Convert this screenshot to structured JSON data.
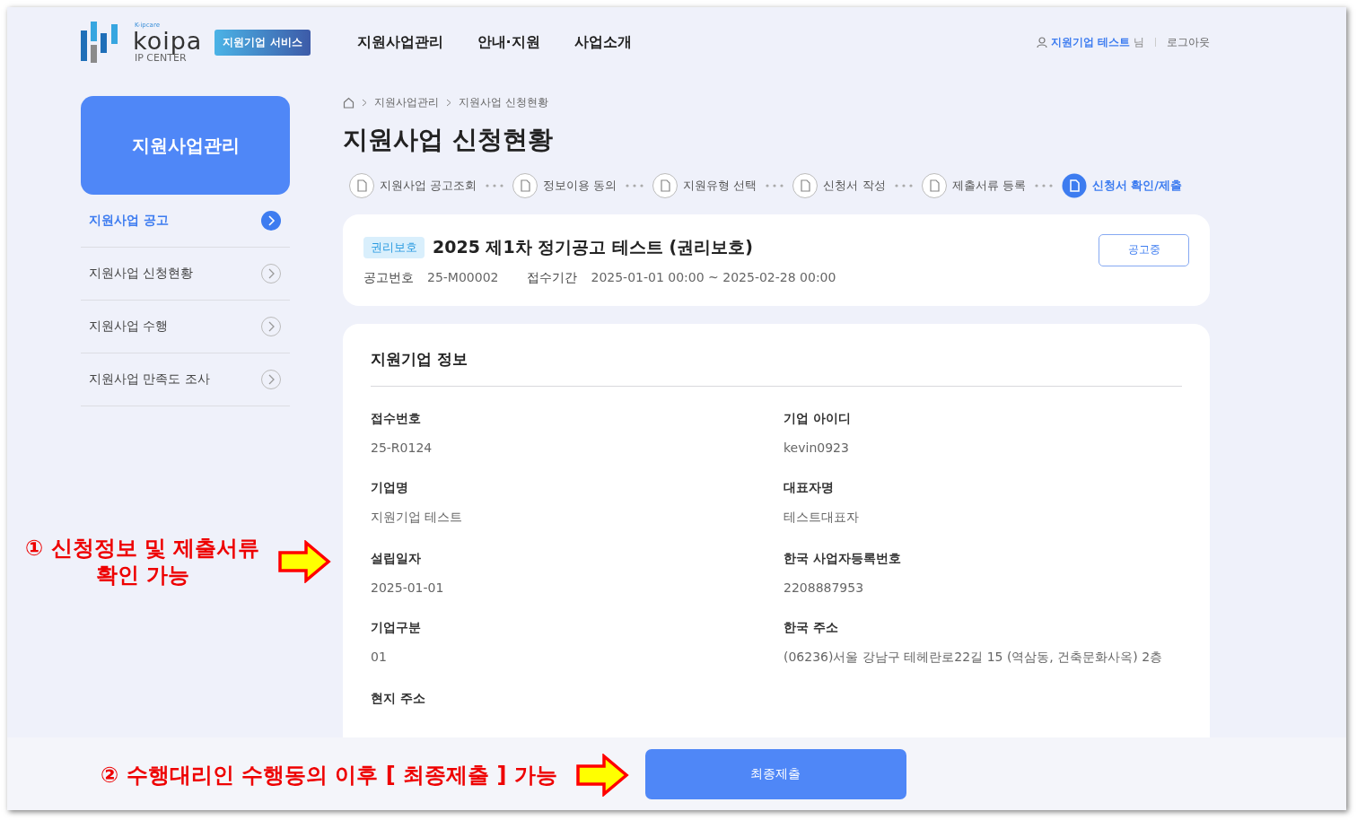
{
  "header": {
    "logo": {
      "tagline": "K-ipcare",
      "name": "koipa",
      "sub": "IP CENTER"
    },
    "service_badge": "지원기업 서비스",
    "nav": [
      "지원사업관리",
      "안내·지원",
      "사업소개"
    ],
    "user": {
      "name": "지원기업 테스트",
      "suffix": "님"
    },
    "logout": "로그아웃"
  },
  "sidebar": {
    "title": "지원사업관리",
    "items": [
      {
        "label": "지원사업 공고",
        "selected": true
      },
      {
        "label": "지원사업 신청현황",
        "selected": false
      },
      {
        "label": "지원사업 수행",
        "selected": false
      },
      {
        "label": "지원사업 만족도 조사",
        "selected": false
      }
    ]
  },
  "breadcrumb": [
    "지원사업관리",
    "지원사업 신청현황"
  ],
  "page_title": "지원사업 신청현황",
  "steps": [
    {
      "label": "지원사업 공고조회",
      "selected": false
    },
    {
      "label": "정보이용 동의",
      "selected": false
    },
    {
      "label": "지원유형 선택",
      "selected": false
    },
    {
      "label": "신청서 작성",
      "selected": false
    },
    {
      "label": "제출서류 등록",
      "selected": false
    },
    {
      "label": "신청서 확인/제출",
      "selected": true
    }
  ],
  "notice": {
    "tag": "권리보호",
    "title": "2025 제1차 정기공고 테스트 (권리보호)",
    "fields": [
      {
        "label": "공고번호",
        "value": "25-M00002"
      },
      {
        "label": "접수기간",
        "value": "2025-01-01 00:00 ~ 2025-02-28 00:00"
      }
    ],
    "status_button": "공고중"
  },
  "company_info": {
    "title": "지원기업 정보",
    "fields": [
      {
        "label": "접수번호",
        "value": "25-R0124"
      },
      {
        "label": "기업 아이디",
        "value": "kevin0923"
      },
      {
        "label": "기업명",
        "value": "지원기업 테스트"
      },
      {
        "label": "대표자명",
        "value": "테스트대표자"
      },
      {
        "label": "설립일자",
        "value": "2025-01-01"
      },
      {
        "label": "한국 사업자등록번호",
        "value": "2208887953"
      },
      {
        "label": "기업구분",
        "value": "01"
      },
      {
        "label": "한국 주소",
        "value": "(06236)서울 강남구 테헤란로22길 15 (역삼동, 건축문화사옥) 2층"
      },
      {
        "label": "현지 주소"
      }
    ]
  },
  "final_button": "최종제출",
  "annotations": [
    {
      "text": "① 신청정보 및 제출서류\n확인 가능"
    },
    {
      "text": "② 수행대리인 수행동의 이후 [ 최종제출 ] 가능"
    }
  ]
}
